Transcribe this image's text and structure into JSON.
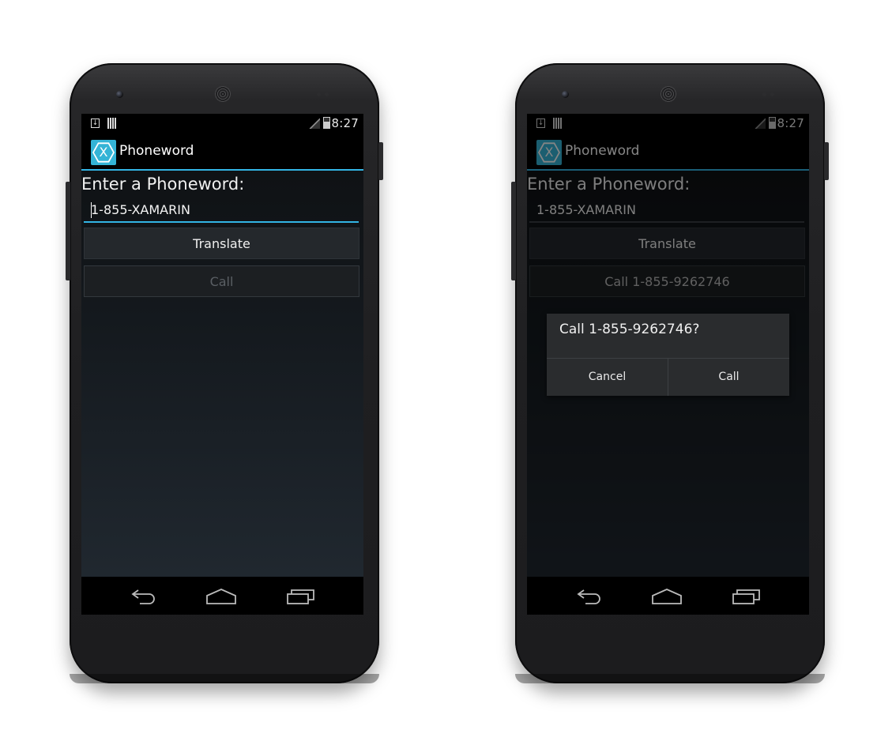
{
  "status_bar": {
    "time": "8:27"
  },
  "app": {
    "title": "Phoneword"
  },
  "screen_left": {
    "prompt": "Enter a Phoneword:",
    "input_value": "1-855-XAMARIN",
    "translate_button": "Translate",
    "call_button": "Call"
  },
  "screen_right": {
    "prompt": "Enter a Phoneword:",
    "input_value": "1-855-XAMARIN",
    "translate_button": "Translate",
    "call_button": "Call 1-855-9262746",
    "dialog": {
      "message": "Call 1-855-9262746?",
      "cancel_button": "Cancel",
      "call_button": "Call"
    }
  },
  "icons": {
    "app_icon": "xamarin-x-hex-icon",
    "status_icons": [
      "download-icon",
      "barcode-icon",
      "signal-icon",
      "battery-icon"
    ],
    "nav_icons": [
      "back-icon",
      "home-icon",
      "recents-icon"
    ]
  },
  "colors": {
    "accent": "#33b5e5",
    "app_icon_bg": "#34b4d6",
    "phone_body": "#1f1f21"
  }
}
